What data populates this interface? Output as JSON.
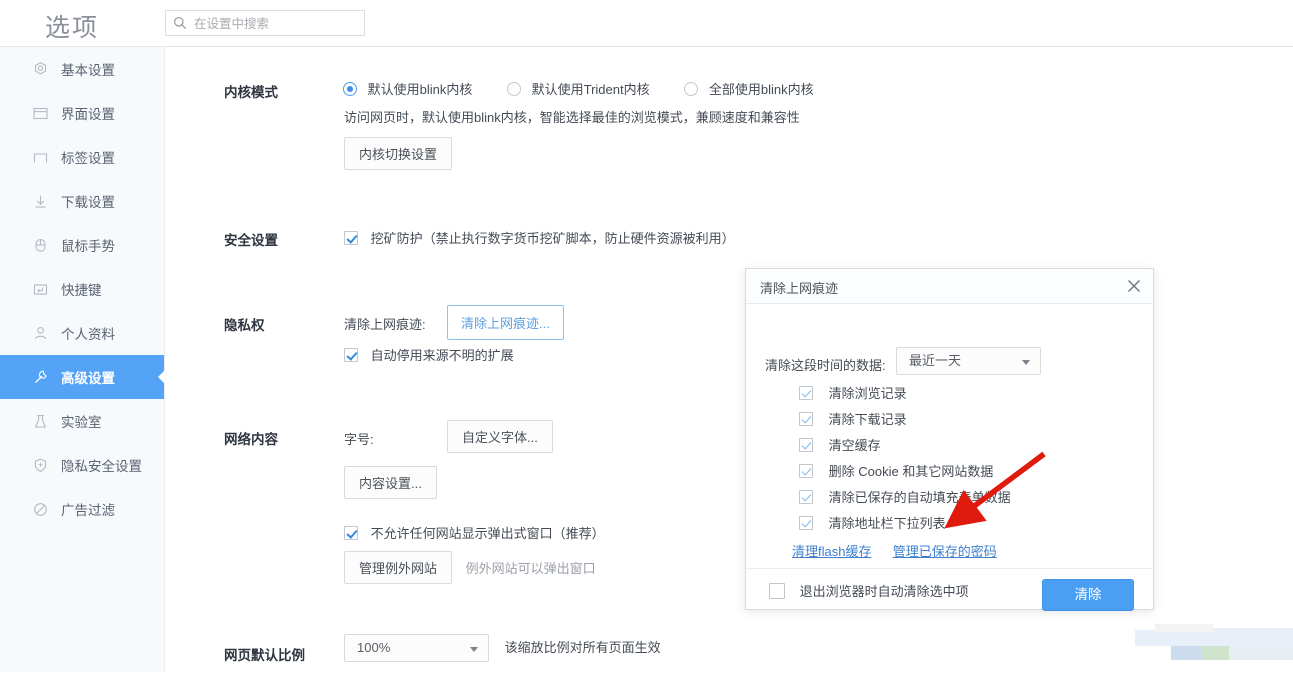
{
  "header": {
    "title": "选项",
    "search": {
      "value": "",
      "placeholder": "在设置中搜索",
      "icon": "search-icon"
    }
  },
  "sidebar": {
    "items": [
      {
        "label": "基本设置",
        "icon": "gear-circle-icon",
        "active": false
      },
      {
        "label": "界面设置",
        "icon": "window-icon",
        "active": false
      },
      {
        "label": "标签设置",
        "icon": "tab-icon",
        "active": false
      },
      {
        "label": "下载设置",
        "icon": "download-icon",
        "active": false
      },
      {
        "label": "鼠标手势",
        "icon": "mouse-icon",
        "active": false
      },
      {
        "label": "快捷键",
        "icon": "keyboard-key-icon",
        "active": false
      },
      {
        "label": "个人资料",
        "icon": "user-icon",
        "active": false
      },
      {
        "label": "高级设置",
        "icon": "wrench-icon",
        "active": true
      },
      {
        "label": "实验室",
        "icon": "flask-icon",
        "active": false
      },
      {
        "label": "隐私安全设置",
        "icon": "shield-plus-icon",
        "active": false
      },
      {
        "label": "广告过滤",
        "icon": "block-icon",
        "active": false
      }
    ]
  },
  "main": {
    "kernel": {
      "label": "内核模式",
      "radios": [
        {
          "label": "默认使用blink内核",
          "checked": true
        },
        {
          "label": "默认使用Trident内核",
          "checked": false
        },
        {
          "label": "全部使用blink内核",
          "checked": false
        }
      ],
      "description": "访问网页时，默认使用blink内核，智能选择最佳的浏览模式，兼顾速度和兼容性",
      "button": "内核切换设置"
    },
    "security": {
      "label": "安全设置",
      "checkbox": {
        "label": "挖矿防护（禁止执行数字货币挖矿脚本，防止硬件资源被利用）",
        "checked": true
      }
    },
    "privacy": {
      "label": "隐私权",
      "clear_label": "清除上网痕迹:",
      "clear_button": "清除上网痕迹...",
      "checkbox": {
        "label": "自动停用来源不明的扩展",
        "checked": true
      }
    },
    "web_content": {
      "label": "网络内容",
      "font_size_label": "字号:",
      "custom_font_button": "自定义字体...",
      "content_settings_button": "内容设置...",
      "popup_checkbox": {
        "label": "不允许任何网站显示弹出式窗口（推荐）",
        "checked": true
      },
      "exception_button": "管理例外网站",
      "exception_hint": "例外网站可以弹出窗口"
    },
    "zoom": {
      "label": "网页默认比例",
      "value": "100%",
      "hint": "该缩放比例对所有页面生效"
    }
  },
  "dialog": {
    "title": "清除上网痕迹",
    "close_icon": "close-icon",
    "time_label": "清除这段时间的数据:",
    "time_value": "最近一天",
    "checkboxes": [
      {
        "label": "清除浏览记录",
        "checked": true
      },
      {
        "label": "清除下载记录",
        "checked": true
      },
      {
        "label": "清空缓存",
        "checked": true
      },
      {
        "label": "删除 Cookie 和其它网站数据",
        "checked": true
      },
      {
        "label": "清除已保存的自动填充表单数据",
        "checked": true
      },
      {
        "label": "清除地址栏下拉列表",
        "checked": true
      }
    ],
    "links": [
      {
        "label": "清理flash缓存"
      },
      {
        "label": "管理已保存的密码"
      }
    ],
    "footer_checkbox": {
      "label": "退出浏览器时自动清除选中项",
      "checked": false
    },
    "confirm_button": "清除"
  },
  "annotation": {
    "arrow_color": "#e01b0e"
  },
  "colors": {
    "accent": "#4a9ff2",
    "sidebar_active_bg": "#54a3f7",
    "link": "#3e7fd0",
    "text": "#333333"
  }
}
